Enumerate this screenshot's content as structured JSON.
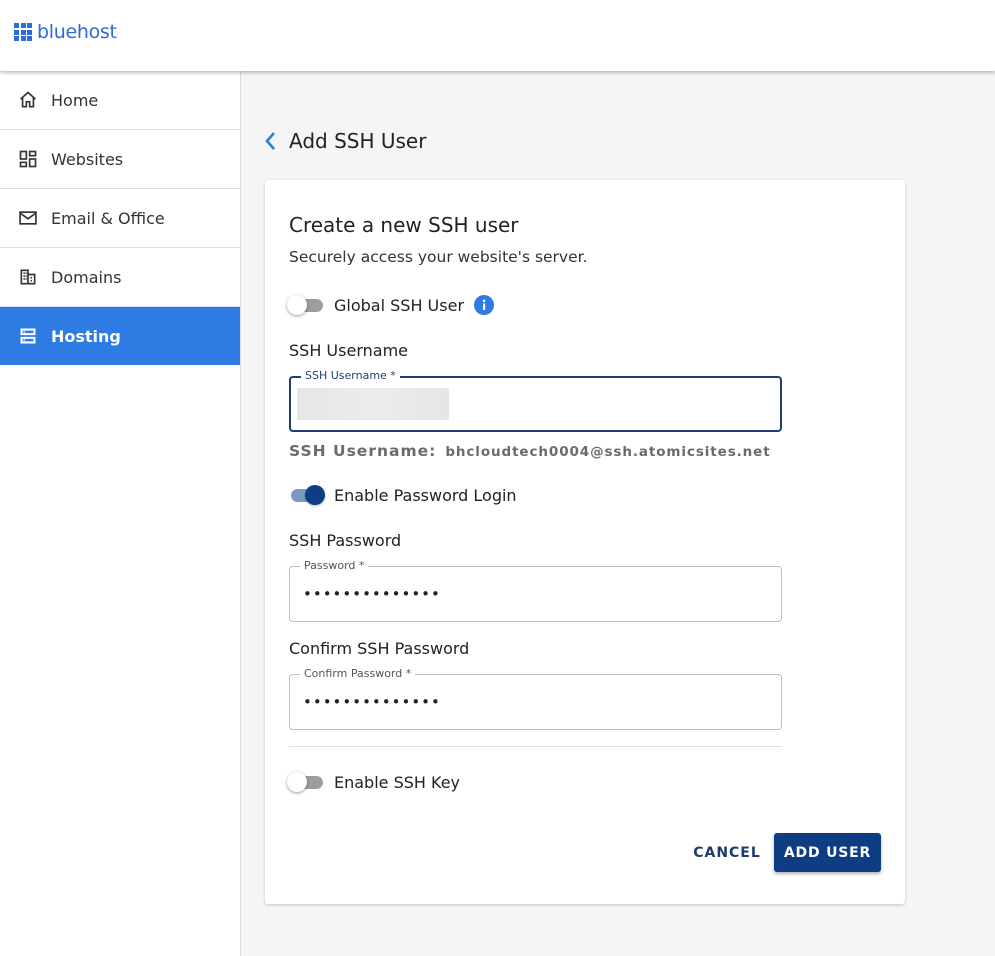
{
  "brand": {
    "name": "bluehost",
    "color": "#2e6ad8"
  },
  "sidebar": {
    "items": [
      {
        "label": "Home",
        "icon": "home-icon",
        "active": false
      },
      {
        "label": "Websites",
        "icon": "dashboard-grid-icon",
        "active": false
      },
      {
        "label": "Email & Office",
        "icon": "mail-icon",
        "active": false
      },
      {
        "label": "Domains",
        "icon": "building-icon",
        "active": false
      },
      {
        "label": "Hosting",
        "icon": "server-icon",
        "active": true
      }
    ],
    "active_color": "#2d7be3"
  },
  "page": {
    "title": "Add SSH User",
    "back_icon": "chevron-left-icon"
  },
  "card": {
    "title": "Create a new SSH user",
    "subtitle": "Securely access your website's server.",
    "global_ssh": {
      "label": "Global SSH User",
      "enabled": false,
      "info_icon": "info-icon"
    },
    "username": {
      "section_label": "SSH Username",
      "field_label": "SSH Username *",
      "value": "",
      "helper_key": "SSH Username:",
      "helper_value": "bhcloudtech0004@ssh.atomicsites.net"
    },
    "password_login": {
      "label": "Enable Password Login",
      "enabled": true
    },
    "password": {
      "section_label": "SSH Password",
      "field_label": "Password  *",
      "value": "••••••••••••••"
    },
    "confirm_password": {
      "section_label": "Confirm SSH Password",
      "field_label": "Confirm Password *",
      "value": "••••••••••••••"
    },
    "ssh_key": {
      "label": "Enable SSH Key",
      "enabled": false
    },
    "actions": {
      "cancel": "CANCEL",
      "submit": "ADD USER"
    }
  },
  "colors": {
    "primary_dark": "#0f3d84",
    "toggle_track_on": "#7b99c4",
    "link_blue": "#2d7be3"
  }
}
